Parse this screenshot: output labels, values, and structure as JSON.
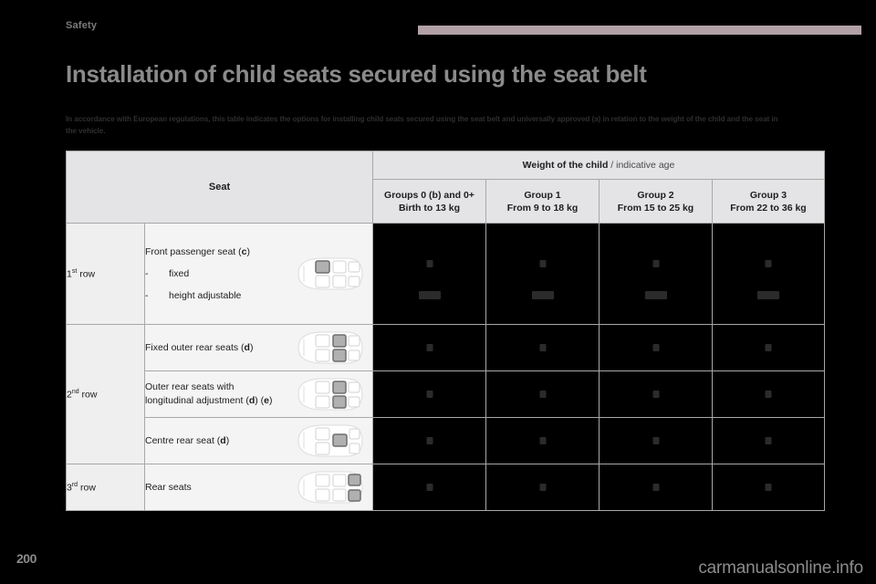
{
  "header": {
    "section_label": "Safety",
    "rule_color": "#b3a0a7"
  },
  "title": "Installation of child seats secured using the seat belt",
  "intro": "In accordance with European regulations, this table indicates the options for installing child seats secured using the seat belt and universally approved (a) in relation to the weight of the child and the seat in the vehicle.",
  "table": {
    "seat_header": "Seat",
    "weight_header_bold": "Weight of the child",
    "weight_header_rest": " / indicative age",
    "groups": [
      {
        "line1": "Groups 0 (b) and 0+",
        "line2": "Birth to 13 kg"
      },
      {
        "line1": "Group 1",
        "line2": "From 9 to 18 kg"
      },
      {
        "line1": "Group 2",
        "line2": "From 15 to 25 kg"
      },
      {
        "line1": "Group 3",
        "line2": "From 22 to 36 kg"
      }
    ],
    "rows": [
      {
        "group_label_text": "1",
        "group_label_sup": "st",
        "group_label_suffix": " row",
        "seats": [
          {
            "title": "Front passenger seat (c)",
            "option1": "fixed",
            "option2": "height adjustable",
            "dash": "-",
            "diagram": "car-top-view-front-passenger-highlighted"
          }
        ]
      },
      {
        "group_label_text": "2",
        "group_label_sup": "nd",
        "group_label_suffix": " row",
        "seats": [
          {
            "title": "Fixed outer rear seats (d)",
            "diagram": "car-top-view-outer-rear-highlighted"
          },
          {
            "title_line1": "Outer rear seats with",
            "title_line2": "longitudinal adjustment (d) (e)",
            "diagram": "car-top-view-outer-rear-highlighted"
          },
          {
            "title": "Centre rear seat (d)",
            "diagram": "car-top-view-centre-rear-highlighted"
          }
        ]
      },
      {
        "group_label_text": "3",
        "group_label_sup": "rd",
        "group_label_suffix": " row",
        "seats": [
          {
            "title": "Rear seats",
            "diagram": "car-top-view-third-row-highlighted"
          }
        ]
      }
    ],
    "cell_fill_color": "#000000",
    "cell_mark_color": "#2b2b2b"
  },
  "footer": {
    "page_number": "200",
    "watermark": "carmanualsonline.info"
  }
}
